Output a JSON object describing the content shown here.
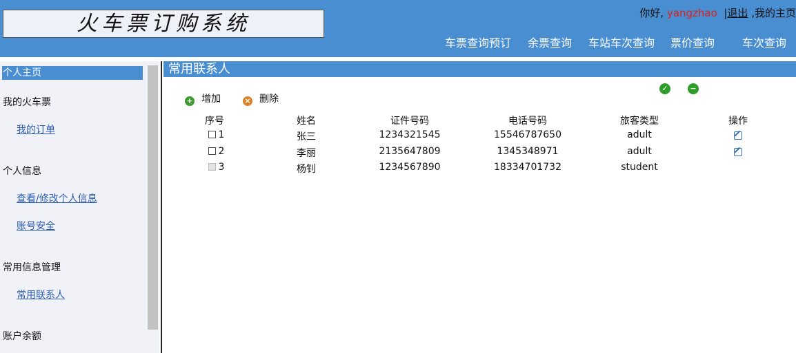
{
  "header": {
    "logo_text": "火车票订购系统",
    "greeting": "你好,",
    "username": "yangzhao",
    "logout": "退出",
    "home_link": ",我的主页",
    "nav": [
      "车票查询预订",
      "余票查询",
      "车站车次查询",
      "票价查询",
      "车次查询"
    ]
  },
  "sidebar": {
    "home": "个人主页",
    "sections": [
      {
        "title": "我的火车票",
        "links": [
          "我的订单"
        ]
      },
      {
        "title": "个人信息",
        "links": [
          "查看/修改个人信息",
          "账号安全"
        ]
      },
      {
        "title": "常用信息管理",
        "links": [
          "常用联系人"
        ]
      },
      {
        "title": "账户余额",
        "links": []
      }
    ]
  },
  "main": {
    "title": "常用联系人",
    "toolbar": {
      "add": "增加",
      "delete": "删除"
    },
    "icons": {
      "confirm": "check-circle-icon",
      "remove": "minus-circle-icon",
      "edit": "edit-icon"
    },
    "table": {
      "columns": [
        "序号",
        "姓名",
        "证件号码",
        "电话号码",
        "旅客类型",
        "操作"
      ],
      "rows": [
        {
          "no": "1",
          "name": "张三",
          "id": "1234321545",
          "phone": "15546787650",
          "type": "adult",
          "editable": true
        },
        {
          "no": "2",
          "name": "李丽",
          "id": "2135647809",
          "phone": "1345348971",
          "type": "adult",
          "editable": true
        },
        {
          "no": "3",
          "name": "杨钊",
          "id": "1234567890",
          "phone": "18334701732",
          "type": "student",
          "editable": false
        }
      ]
    }
  },
  "colors": {
    "accent": "#4a8ed2",
    "username": "#e0201a",
    "link": "#2a5cb0"
  }
}
